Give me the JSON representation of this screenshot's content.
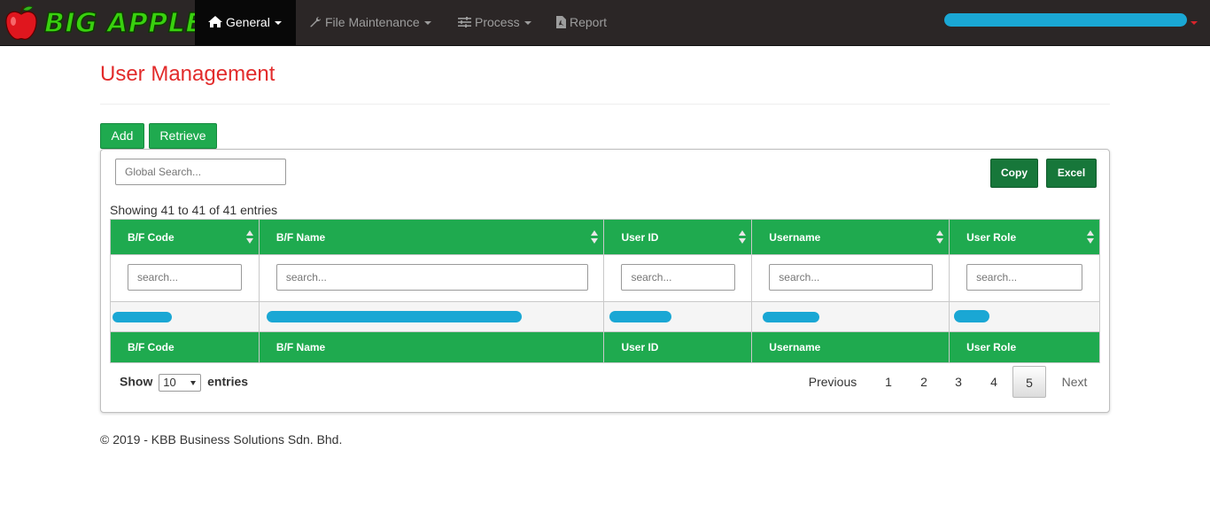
{
  "navbar": {
    "brand": "BIG APPLE",
    "items": [
      {
        "label": "General",
        "icon": "home-icon",
        "active": true,
        "dropdown": true
      },
      {
        "label": "File Maintenance",
        "icon": "wrench-icon",
        "active": false,
        "dropdown": true
      },
      {
        "label": "Process",
        "icon": "sliders-icon",
        "active": false,
        "dropdown": true
      },
      {
        "label": "Report",
        "icon": "pdf-file-icon",
        "active": false,
        "dropdown": false
      }
    ]
  },
  "page": {
    "title": "User Management"
  },
  "actions": {
    "add_label": "Add",
    "retrieve_label": "Retrieve"
  },
  "table": {
    "global_search_placeholder": "Global Search...",
    "copy_label": "Copy",
    "excel_label": "Excel",
    "info": "Showing 41 to 41 of 41 entries",
    "columns": [
      "B/F Code",
      "B/F Name",
      "User ID",
      "Username",
      "User Role"
    ],
    "filter_placeholder": "search...",
    "show_label": "Show",
    "page_length": "10",
    "entries_label": "entries",
    "pagination": {
      "previous": "Previous",
      "pages": [
        "1",
        "2",
        "3",
        "4",
        "5"
      ],
      "current": "5",
      "next": "Next"
    }
  },
  "footer": {
    "text": "© 2019 - KBB Business Solutions Sdn. Bhd."
  },
  "colors": {
    "navbar_bg": "#2b2626",
    "accent_green": "#1faa4f",
    "title_red": "#e22b2b",
    "redaction": "#1aa7d4"
  }
}
